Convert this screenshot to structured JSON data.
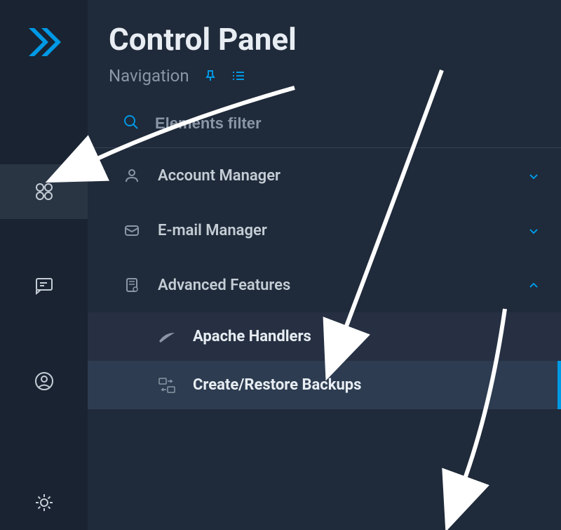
{
  "header": {
    "title": "Control Panel",
    "subtitle": "Navigation"
  },
  "search": {
    "placeholder": "Elements filter"
  },
  "menu": {
    "items": [
      {
        "label": "Account Manager"
      },
      {
        "label": "E-mail Manager"
      },
      {
        "label": "Advanced Features"
      }
    ],
    "advanced_sub": [
      {
        "label": "Apache Handlers"
      },
      {
        "label": "Create/Restore Backups"
      }
    ]
  },
  "colors": {
    "accent": "#0099e5",
    "bg": "#1a2332",
    "panel": "#1f2a3a"
  }
}
